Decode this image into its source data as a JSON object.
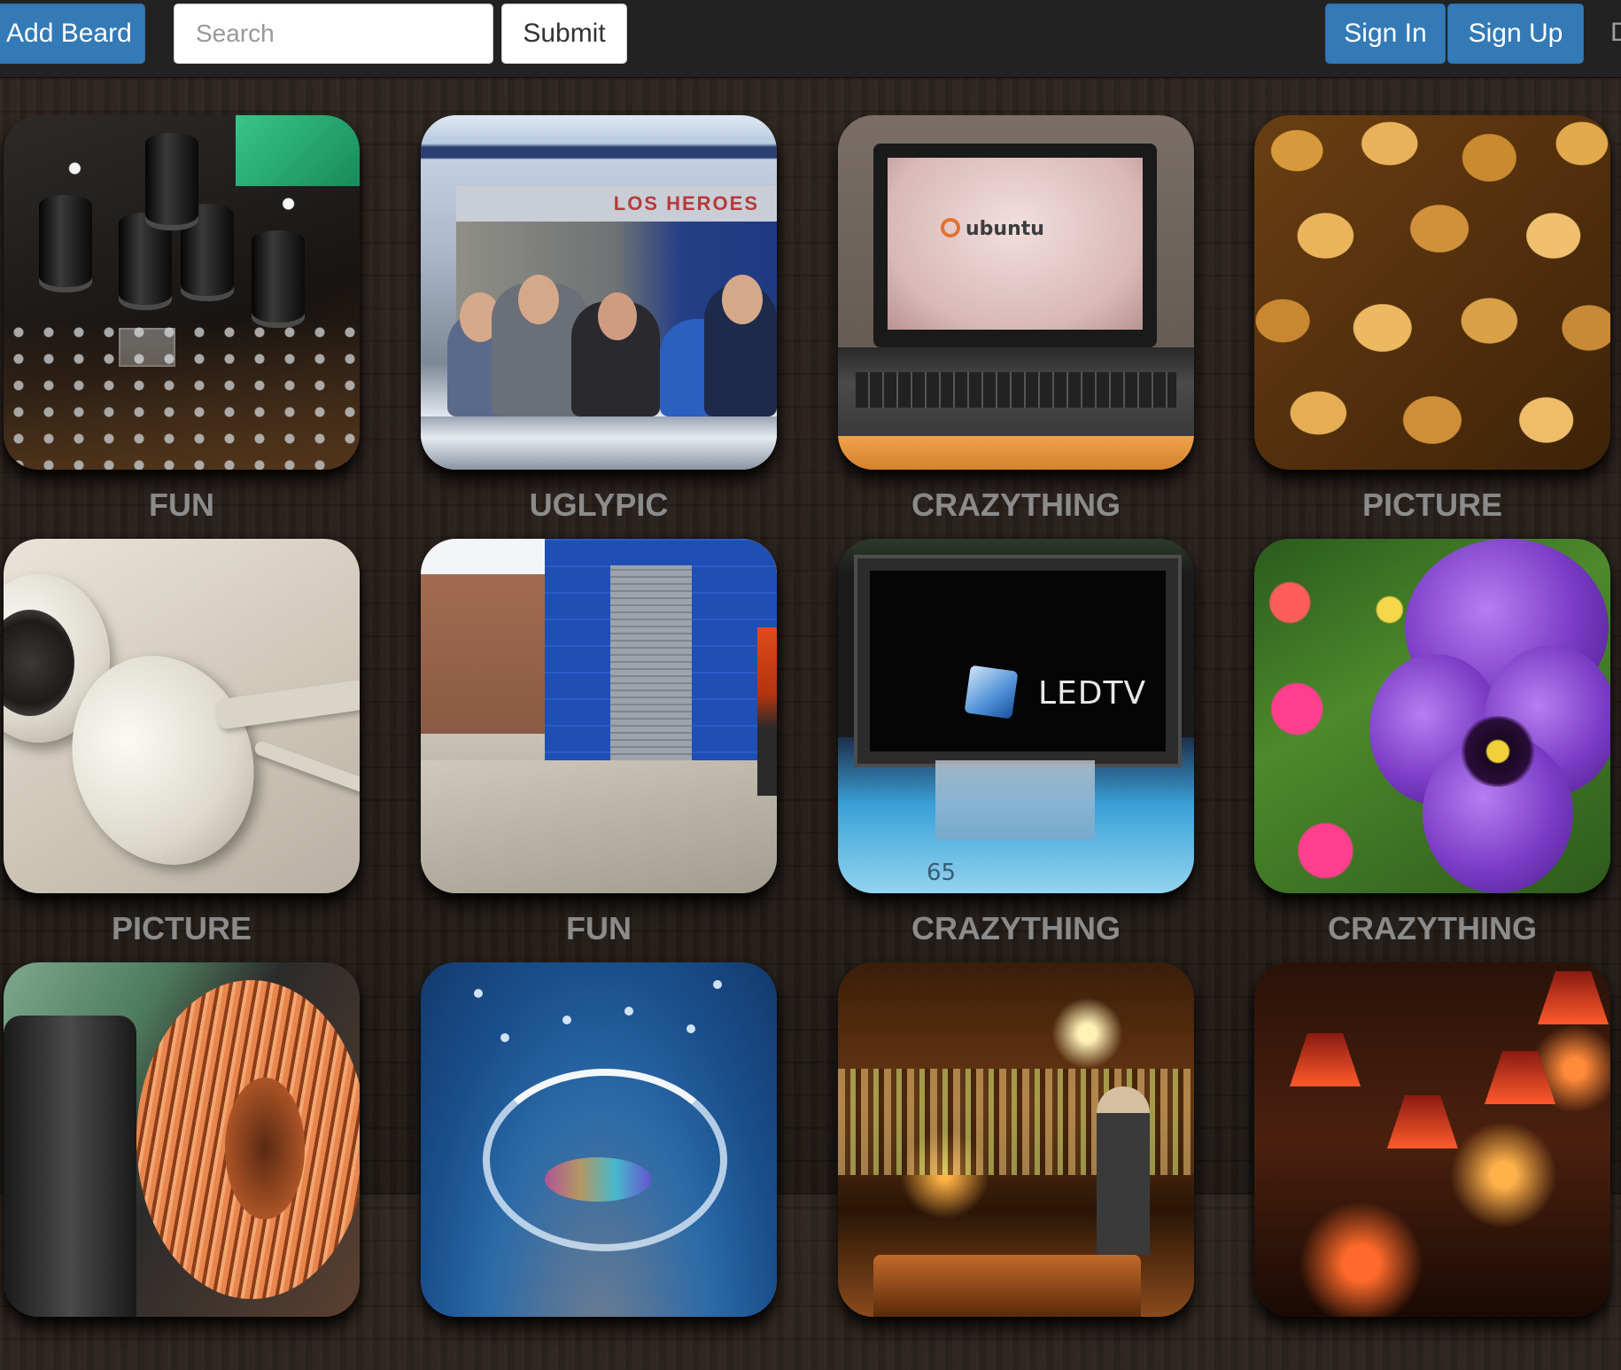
{
  "navbar": {
    "add_beard_label": "Add Beard",
    "search_placeholder": "Search",
    "search_value": "",
    "submit_label": "Submit",
    "sign_in_label": "Sign In",
    "sign_up_label": "Sign Up",
    "cut_off_label": "D"
  },
  "tiles": [
    {
      "label": "FUN"
    },
    {
      "label": "UGLYPIC",
      "sign_text": "LOS HEROES"
    },
    {
      "label": "CRAZYTHING",
      "screen_text": "ubuntu"
    },
    {
      "label": "PICTURE"
    },
    {
      "label": "PICTURE"
    },
    {
      "label": "FUN"
    },
    {
      "label": "CRAZYTHING",
      "screen_text": "LEDTV",
      "stand_text": "65"
    },
    {
      "label": "CRAZYTHING"
    },
    {
      "label": ""
    },
    {
      "label": ""
    },
    {
      "label": ""
    },
    {
      "label": ""
    }
  ],
  "colors": {
    "navbar_bg": "#222222",
    "primary_button": "#337ab7",
    "label_gray": "#8c8c8c",
    "page_bg": "#241c17"
  }
}
